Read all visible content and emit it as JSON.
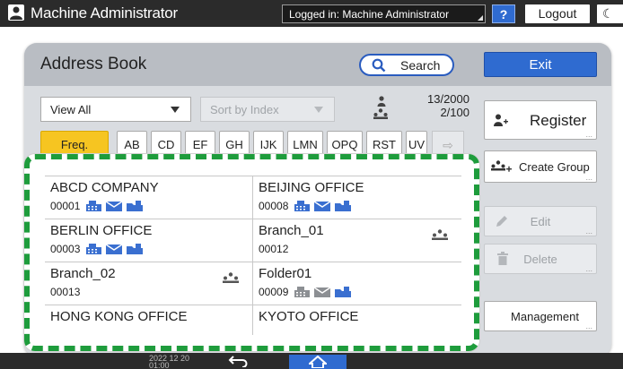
{
  "topbar": {
    "title": "Machine Administrator",
    "logged_in": "Logged in: Machine Administrator",
    "help_label": "?",
    "logout_label": "Logout",
    "moon_label": "☾"
  },
  "panel": {
    "title": "Address Book",
    "search_label": "Search",
    "exit_label": "Exit"
  },
  "controls": {
    "view_select": "View All",
    "sort_select": "Sort by Index",
    "user_count": "13/2000",
    "group_count": "2/100"
  },
  "tabs": [
    {
      "label": "Freq.",
      "active": true
    },
    {
      "label": "AB"
    },
    {
      "label": "CD"
    },
    {
      "label": "EF"
    },
    {
      "label": "GH"
    },
    {
      "label": "IJK"
    },
    {
      "label": "LMN"
    },
    {
      "label": "OPQ"
    },
    {
      "label": "RST"
    },
    {
      "label": "UV"
    }
  ],
  "side": {
    "register": "Register",
    "create_group": "Create Group",
    "edit": "Edit",
    "delete": "Delete",
    "management": "Management"
  },
  "entries": [
    {
      "name": "ABCD COMPANY",
      "number": "00001",
      "icons": [
        "fax-icon",
        "email-icon",
        "folder-icon"
      ]
    },
    {
      "name": "BEIJING OFFICE",
      "number": "00008",
      "icons": [
        "fax-icon",
        "email-icon",
        "folder-icon"
      ]
    },
    {
      "name": "BERLIN OFFICE",
      "number": "00003",
      "icons": [
        "fax-icon",
        "email-icon",
        "folder-icon"
      ]
    },
    {
      "name": "Branch_01",
      "number": "00012",
      "group": true
    },
    {
      "name": "Branch_02",
      "number": "00013",
      "group": true
    },
    {
      "name": "Folder01",
      "number": "00009",
      "icons": [
        "fax-icon-gray",
        "email-icon-gray",
        "folder-icon"
      ]
    },
    {
      "name": "HONG KONG OFFICE",
      "number": ""
    },
    {
      "name": "KYOTO OFFICE",
      "number": ""
    }
  ],
  "bottombar": {
    "clock_date": "2022 12 20",
    "clock_time": "01:00"
  },
  "colors": {
    "accent_blue": "#2f6bd0",
    "active_tab": "#f6c521",
    "highlight_dash": "#1e9c3c"
  }
}
